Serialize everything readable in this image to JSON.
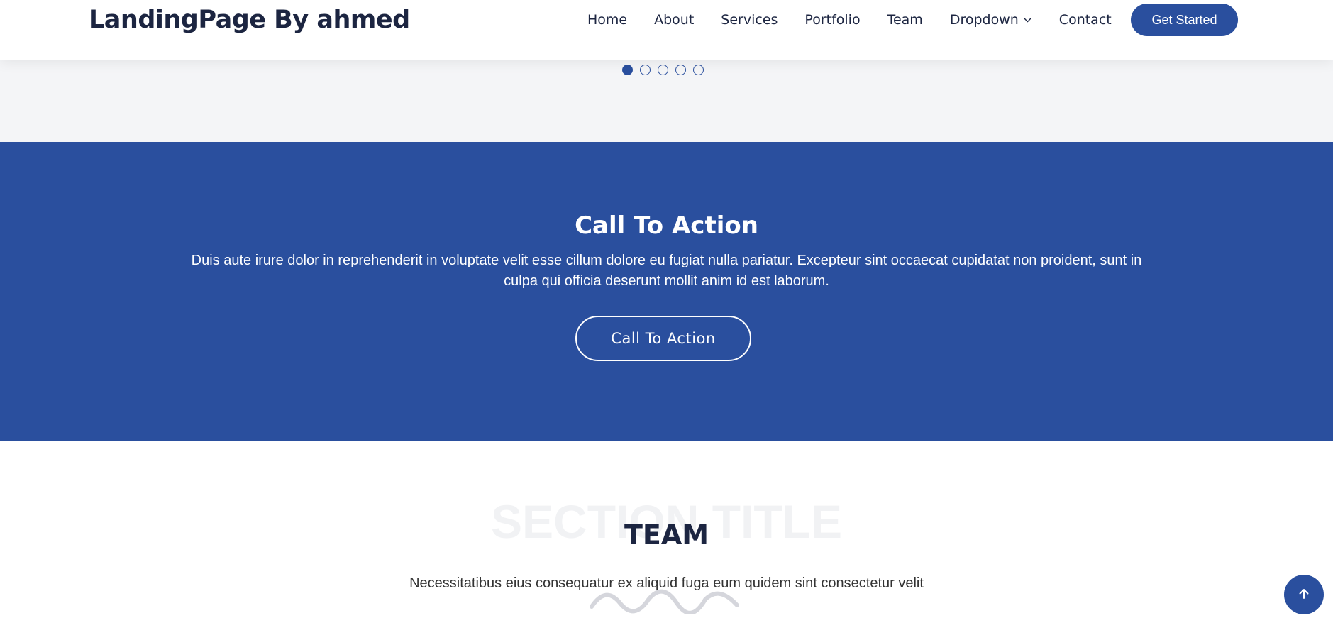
{
  "header": {
    "logo": "LandingPage By ahmed",
    "nav": [
      {
        "label": "Home"
      },
      {
        "label": "About"
      },
      {
        "label": "Services"
      },
      {
        "label": "Portfolio"
      },
      {
        "label": "Team"
      },
      {
        "label": "Dropdown",
        "icon": "chevron-down-icon"
      },
      {
        "label": "Contact"
      }
    ],
    "cta_label": "Get Started"
  },
  "slider": {
    "dot_count": 5,
    "active_index": 0
  },
  "cta": {
    "title": "Call To Action",
    "text": "Duis aute irure dolor in reprehenderit in voluptate velit esse cillum dolore eu fugiat nulla pariatur. Excepteur sint occaecat cupidatat non proident, sunt in culpa qui officia deserunt mollit anim id est laborum.",
    "button_label": "Call To Action"
  },
  "team": {
    "background_title": "SECTION TITLE",
    "title": "TEAM",
    "subtitle": "Necessitatibus eius consequatur ex aliquid fuga eum quidem sint consectetur velit"
  },
  "back_to_top": {
    "icon": "arrow-up-icon"
  },
  "colors": {
    "primary": "#2a4f9e",
    "dark": "#1c2541",
    "light_bg": "#f4f5f7"
  }
}
